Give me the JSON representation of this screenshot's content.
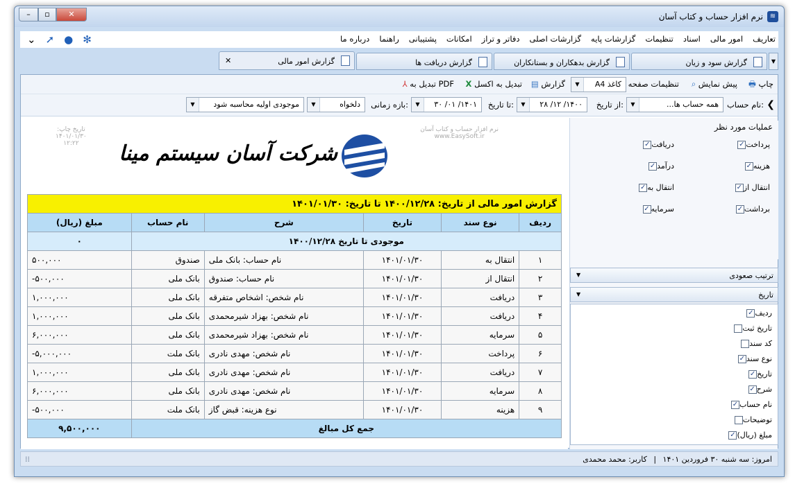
{
  "window": {
    "title": "نرم افزار حساب و کتاب آسان",
    "close": "✕",
    "maximize": "▫",
    "minimize": "–"
  },
  "menu": {
    "items": [
      "تعاریف",
      "امور مالی",
      "اسناد",
      "تنظیمات",
      "گزارشات پایه",
      "گزارشات اصلی",
      "دفاتر و تراز",
      "امکانات",
      "پشتیبانی",
      "راهنما",
      "درباره ما"
    ]
  },
  "tabs": [
    {
      "label": "گزارش سود و زیان"
    },
    {
      "label": "گزارش بدهکاران و بستانکاران"
    },
    {
      "label": "گزارش دریافت ها"
    },
    {
      "label": "گزارش امور مالی"
    }
  ],
  "toolbar": {
    "print": "چاپ",
    "preview": "پیش نمایش",
    "page_settings": "تنظیمات صفحه",
    "paper": "کاغذ A4",
    "report": "گزارش",
    "excel": "تبدیل به اکسل",
    "pdf": "تبدیل به PDF"
  },
  "filters": {
    "account_label": "نام حساب:",
    "account_value": "همه حساب ها...",
    "from_label": "از تاریخ:",
    "from_value": "۱۴۰۰/ ۱۲/ ۲۸",
    "to_label": "تا تاریخ:",
    "to_value": "۱۴۰۱/ ۰۱/ ۳۰",
    "period_label": "بازه زمانی:",
    "period_value": "دلخواه",
    "opening_value": "موجودی اولیه محاسبه شود"
  },
  "report": {
    "watermark_right": "نرم افزار حساب و کتاب آسان",
    "watermark_site": "www.EasySoft.ir",
    "print_date_label": "تاریخ چاپ:",
    "print_date": "۱۴۰۱/۰۱/۳۰",
    "print_time": "۱۲:۲۲",
    "company": "شرکت آسان سیستم مینا",
    "heading": "گزارش امور مالی از تاریخ: ۱۴۰۰/۱۲/۲۸ تا تاریخ: ۱۴۰۱/۰۱/۳۰",
    "columns": [
      "ردیف",
      "نوع سند",
      "تاریخ",
      "شرح",
      "نام حساب",
      "مبلغ (ریال)"
    ],
    "opening_label": "موجودی تا تاریخ ۱۴۰۰/۱۲/۲۸",
    "opening_amount": "۰",
    "rows": [
      [
        "۱",
        "انتقال به",
        "۱۴۰۱/۰۱/۳۰",
        "نام حساب: بانک ملی",
        "صندوق",
        "۵۰۰,۰۰۰"
      ],
      [
        "۲",
        "انتقال از",
        "۱۴۰۱/۰۱/۳۰",
        "نام حساب: صندوق",
        "بانک ملی",
        "-۵۰۰,۰۰۰"
      ],
      [
        "۳",
        "دریافت",
        "۱۴۰۱/۰۱/۳۰",
        "نام شخص: اشخاص متفرقه",
        "بانک ملی",
        "۱,۰۰۰,۰۰۰"
      ],
      [
        "۴",
        "دریافت",
        "۱۴۰۱/۰۱/۳۰",
        "نام شخص: بهزاد شیرمحمدی",
        "بانک ملی",
        "۱,۰۰۰,۰۰۰"
      ],
      [
        "۵",
        "سرمایه",
        "۱۴۰۱/۰۱/۳۰",
        "نام شخص: بهزاد شیرمحمدی",
        "بانک ملی",
        "۶,۰۰۰,۰۰۰"
      ],
      [
        "۶",
        "پرداخت",
        "۱۴۰۱/۰۱/۳۰",
        "نام شخص: مهدی نادری",
        "بانک ملت",
        "-۵,۰۰۰,۰۰۰"
      ],
      [
        "۷",
        "دریافت",
        "۱۴۰۱/۰۱/۳۰",
        "نام شخص: مهدی نادری",
        "بانک ملی",
        "۱,۰۰۰,۰۰۰"
      ],
      [
        "۸",
        "سرمایه",
        "۱۴۰۱/۰۱/۳۰",
        "نام شخص: مهدی نادری",
        "بانک ملی",
        "۶,۰۰۰,۰۰۰"
      ],
      [
        "۹",
        "هزینه",
        "۱۴۰۱/۰۱/۳۰",
        "نوع هزینه: قبض گاز",
        "بانک ملت",
        "-۵۰۰,۰۰۰"
      ]
    ],
    "total_label": "جمع کل مبالغ",
    "total_amount": "۹,۵۰۰,۰۰۰"
  },
  "side": {
    "ops_title": "عملیات مورد نظر",
    "ops": [
      {
        "label": "پرداخت",
        "checked": true
      },
      {
        "label": "دریافت",
        "checked": true
      },
      {
        "label": "هزینه",
        "checked": true
      },
      {
        "label": "درآمد",
        "checked": true
      },
      {
        "label": "انتقال از",
        "checked": true
      },
      {
        "label": "انتقال به",
        "checked": true
      },
      {
        "label": "برداشت",
        "checked": true
      },
      {
        "label": "سرمایه",
        "checked": true
      }
    ],
    "sort_label": "ترتیب صعودی",
    "sort_field": "تاریخ",
    "cols": [
      {
        "label": "ردیف",
        "checked": true
      },
      {
        "label": "تاریخ ثبت",
        "checked": false
      },
      {
        "label": "کد سند",
        "checked": false
      },
      {
        "label": "نوع سند",
        "checked": true
      },
      {
        "label": "تاریخ",
        "checked": true
      },
      {
        "label": "شرح",
        "checked": true
      },
      {
        "label": "نام حساب",
        "checked": true
      },
      {
        "label": "توضیحات",
        "checked": false
      },
      {
        "label": "مبلغ (ریال)",
        "checked": true
      }
    ]
  },
  "status": {
    "today": "امروز: سه شنبه ۳۰ فروردین ۱۴۰۱",
    "sep": "|",
    "user": "کاربر: محمد محمدی"
  }
}
